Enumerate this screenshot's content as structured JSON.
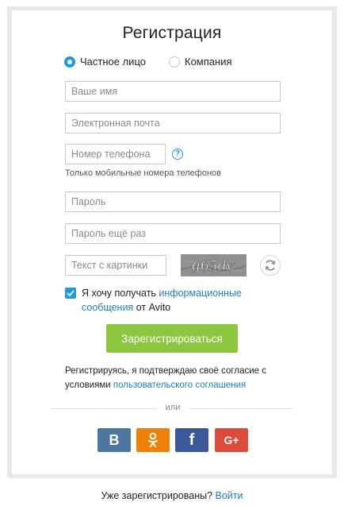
{
  "form": {
    "title": "Регистрация",
    "account_types": [
      {
        "label": "Частное лицо",
        "selected": true
      },
      {
        "label": "Компания",
        "selected": false
      }
    ],
    "fields": {
      "name_placeholder": "Ваше имя",
      "email_placeholder": "Электронная почта",
      "phone_placeholder": "Номер телефона",
      "phone_hint": "Только мобильные номера телефонов",
      "password_placeholder": "Пароль",
      "password_repeat_placeholder": "Пароль ещё раз",
      "captcha_placeholder": "Текст с картинки",
      "captcha_text": "g65dv"
    },
    "consent": {
      "prefix": "Я хочу получать ",
      "link": "информационные сообщения",
      "suffix": " от Avito",
      "checked": true
    },
    "submit_label": "Зарегистрироваться",
    "agreement": {
      "prefix": "Регистрируясь, я подтверждаю своё согласие с условиями ",
      "link": "пользовательского соглашения"
    },
    "or_label": "или",
    "social": [
      {
        "name": "vk",
        "glyph": "B",
        "color": "#4d76a1"
      },
      {
        "name": "odnoklassniki",
        "glyph": "ok",
        "color": "#ee8208"
      },
      {
        "name": "facebook",
        "glyph": "f",
        "color": "#3b5998"
      },
      {
        "name": "google-plus",
        "glyph": "G+",
        "color": "#dd4b39"
      }
    ]
  },
  "footer": {
    "question": "Уже зарегистрированы? ",
    "login_link": "Войти"
  },
  "colors": {
    "accent": "#1f9bde",
    "submit": "#8dc63f",
    "link": "#1f7fc2"
  }
}
